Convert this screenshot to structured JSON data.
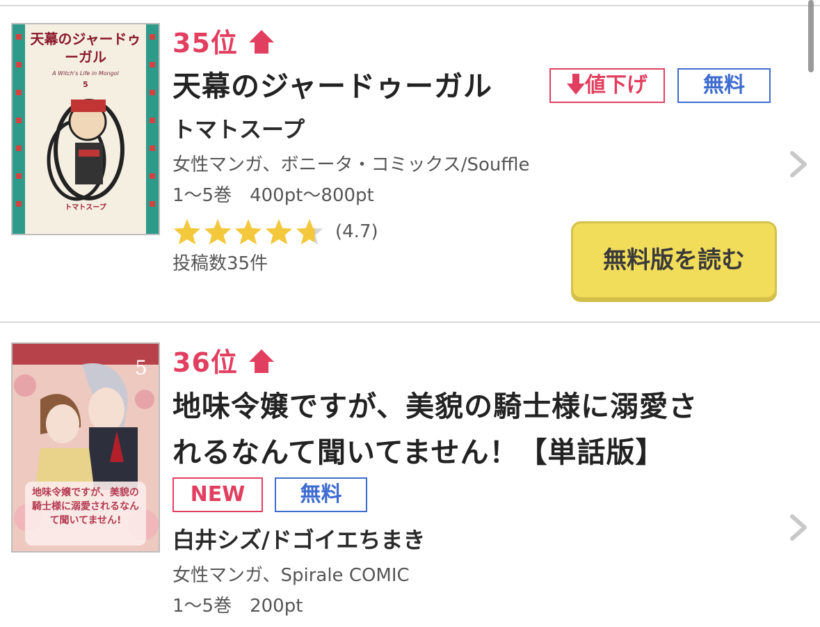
{
  "items": [
    {
      "rank_label": "35位",
      "rank_trend": "up",
      "title": "天幕のジャードゥーガル",
      "badges": {
        "price_drop": "値下げ",
        "free": "無料"
      },
      "author": "トマトスープ",
      "genre_label": "女性マンガ、ボニータ・コミックス/Souffle",
      "volume_price": "1〜5巻　400pt〜800pt",
      "rating": 4.7,
      "rating_text": "(4.7)",
      "review_count": "投稿数35件",
      "read_free_label": "無料版を読む",
      "cover": {
        "title_text": "天幕のジャードゥーガル",
        "subtitle": "A Witch's Life in Mongol",
        "volume": "5",
        "author": "トマトスープ"
      }
    },
    {
      "rank_label": "36位",
      "rank_trend": "up",
      "title_line1": "地味令嬢ですが、美貌の騎士様に溺愛さ",
      "title_line2": "れるなんて聞いてません！【単話版】",
      "badges": {
        "new": "NEW",
        "free": "無料"
      },
      "author": "白井シズ/ドゴイエちまき",
      "genre_label": "女性マンガ、Spirale COMIC",
      "volume_price": "1〜5巻　200pt",
      "cover": {
        "volume": "5",
        "title_text": "地味令嬢ですが、美貌の騎士様に溺愛されるなんて聞いてません!"
      }
    }
  ],
  "colors": {
    "rank": "#e23f60",
    "badge_pink": "#e23f60",
    "badge_blue": "#3d6bd0",
    "button_yellow": "#f2dd5a",
    "star_gold": "#f3c83d",
    "star_empty": "#d6d6d6"
  }
}
